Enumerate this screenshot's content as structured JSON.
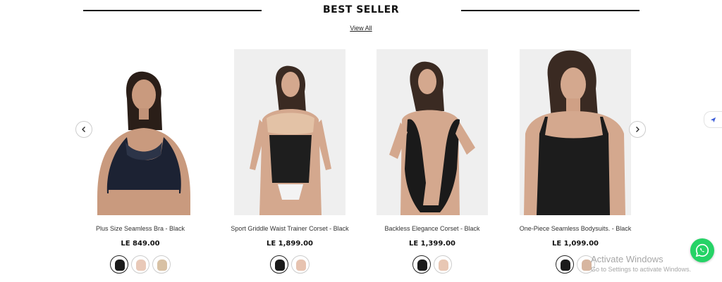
{
  "section": {
    "title": "BEST SELLER",
    "view_all": "View All"
  },
  "products": [
    {
      "title": "Plus Size Seamless Bra - Black",
      "price": "LE 849.00",
      "swatches": [
        "#1b1b1b",
        "#e9c9b8",
        "#d8c1a4"
      ]
    },
    {
      "title": "Sport Griddle Waist Trainer Corset - Black",
      "price": "LE 1,899.00",
      "swatches": [
        "#1b1b1b",
        "#e7c3b0"
      ]
    },
    {
      "title": "Backless Elegance Corset - Black",
      "price": "LE 1,399.00",
      "swatches": [
        "#1b1b1b",
        "#e8c7b4"
      ]
    },
    {
      "title": "One-Piece Seamless Bodysuits. - Black",
      "price": "LE 1,099.00",
      "swatches": [
        "#1b1b1b",
        "#d7b6a0"
      ]
    }
  ],
  "carousel": {
    "prev_icon": "chevron-left-icon",
    "next_icon": "chevron-right-icon"
  },
  "side_tab_icon": "send-icon",
  "whatsapp_icon": "whatsapp-icon",
  "os_overlay": {
    "line1": "Activate Windows",
    "line2": "Go to Settings to activate Windows."
  }
}
